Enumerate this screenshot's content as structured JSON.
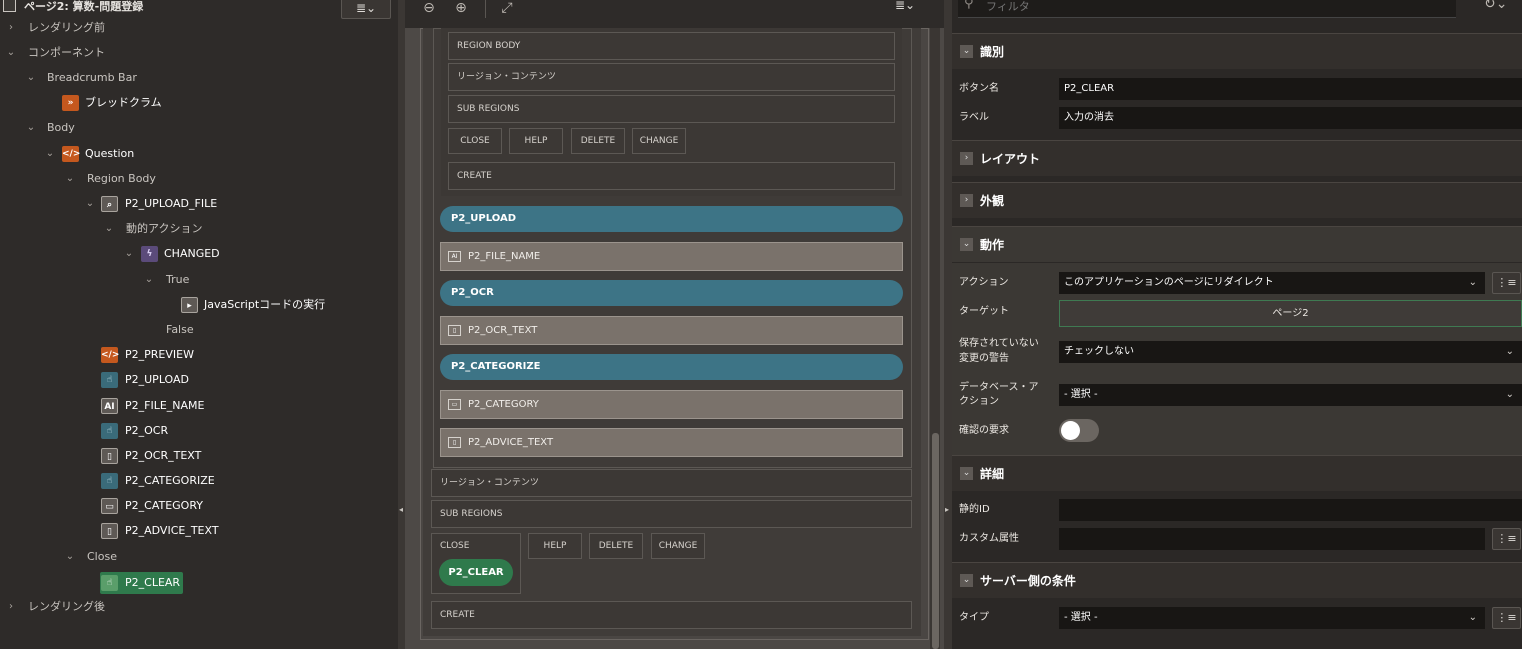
{
  "tree": {
    "page_title": "ページ2: 算数-問題登録",
    "menu_icon": "≣⌄",
    "nodes": [
      {
        "label": "レンダリング前",
        "chevron": "›"
      },
      {
        "label": "コンポーネント",
        "chevron": "⌄"
      },
      {
        "label": "Breadcrumb Bar",
        "chevron": "⌄"
      },
      {
        "label": "ブレッドクラム",
        "icon": "breadcrumb-icon"
      },
      {
        "label": "Body",
        "chevron": "⌄"
      },
      {
        "label": "Question",
        "chevron": "⌄",
        "icon": "code-icon"
      },
      {
        "label": "Region Body",
        "chevron": "⌄"
      },
      {
        "label": "P2_UPLOAD_FILE",
        "chevron": "⌄",
        "icon": "file-browse-icon"
      },
      {
        "label": "動的アクション",
        "chevron": "⌄"
      },
      {
        "label": "CHANGED",
        "chevron": "⌄",
        "icon": "lightning-icon"
      },
      {
        "label": "True",
        "chevron": "⌄"
      },
      {
        "label": "JavaScriptコードの実行",
        "icon": "javascript-action-icon"
      },
      {
        "label": "False"
      },
      {
        "label": "P2_PREVIEW",
        "icon": "code-icon"
      },
      {
        "label": "P2_UPLOAD",
        "icon": "button-icon"
      },
      {
        "label": "P2_FILE_NAME",
        "icon": "text-field-icon"
      },
      {
        "label": "P2_OCR",
        "icon": "button-icon"
      },
      {
        "label": "P2_OCR_TEXT",
        "icon": "textarea-icon"
      },
      {
        "label": "P2_CATEGORIZE",
        "icon": "button-icon"
      },
      {
        "label": "P2_CATEGORY",
        "icon": "select-list-icon"
      },
      {
        "label": "P2_ADVICE_TEXT",
        "icon": "textarea-icon"
      },
      {
        "label": "Close",
        "chevron": "⌄"
      },
      {
        "label": "P2_CLEAR",
        "icon": "button-icon"
      },
      {
        "label": "レンダリング後",
        "chevron": "›"
      }
    ]
  },
  "canvas": {
    "toolbar": {
      "zoom_out": "⊖",
      "zoom_in": "⊕",
      "expand": "⤢",
      "menu": "≣⌄"
    },
    "sub_region": {
      "region_body": "REGION BODY",
      "region_contents": "リージョン・コンテンツ",
      "sub_regions": "SUB REGIONS",
      "buttons": [
        "CLOSE",
        "HELP",
        "DELETE",
        "CHANGE"
      ],
      "create": "CREATE"
    },
    "items": [
      {
        "kind": "button",
        "label": "P2_UPLOAD"
      },
      {
        "kind": "field",
        "label": "P2_FILE_NAME",
        "icon": "AI"
      },
      {
        "kind": "button",
        "label": "P2_OCR"
      },
      {
        "kind": "field",
        "label": "P2_OCR_TEXT",
        "icon": "▯"
      },
      {
        "kind": "button",
        "label": "P2_CATEGORIZE"
      },
      {
        "kind": "field",
        "label": "P2_CATEGORY",
        "icon": "▭"
      },
      {
        "kind": "field",
        "label": "P2_ADVICE_TEXT",
        "icon": "▯"
      }
    ],
    "outer": {
      "region_contents": "リージョン・コンテンツ",
      "sub_regions": "SUB REGIONS",
      "close": "CLOSE",
      "buttons": [
        "HELP",
        "DELETE",
        "CHANGE"
      ],
      "clear_button": "P2_CLEAR",
      "create": "CREATE"
    }
  },
  "props": {
    "filter_placeholder": "フィルタ",
    "sections": {
      "identification": "識別",
      "layout": "レイアウト",
      "appearance": "外観",
      "behavior": "動作",
      "advanced": "詳細",
      "server_condition": "サーバー側の条件"
    },
    "button_name_label": "ボタン名",
    "button_name_value": "P2_CLEAR",
    "label_label": "ラベル",
    "label_value": "入力の消去",
    "action_label": "アクション",
    "action_value": "このアプリケーションのページにリダイレクト",
    "target_label": "ターゲット",
    "target_value": "ページ2",
    "warn_label_1": "保存されていない",
    "warn_label_2": "変更の警告",
    "warn_value": "チェックしない",
    "db_label_1": "データベース・ア",
    "db_label_2": "クション",
    "db_value": "- 選択 -",
    "confirm_label": "確認の要求",
    "confirm_on": false,
    "static_id_label": "静的ID",
    "static_id_value": "",
    "custom_attr_label": "カスタム属性",
    "custom_attr_value": "",
    "type_label": "タイプ",
    "type_value": "- 選択 -"
  }
}
